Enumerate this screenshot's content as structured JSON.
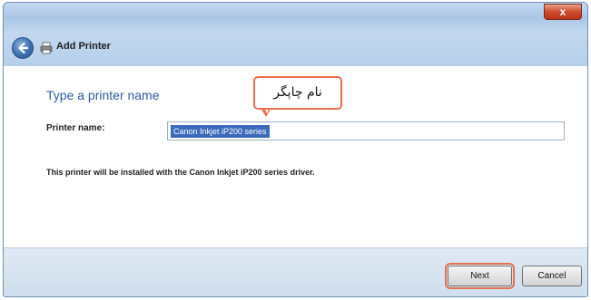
{
  "window": {
    "close_glyph": "x"
  },
  "navbar": {
    "title": "Add Printer",
    "back_icon": "back-arrow-icon",
    "printer_icon": "printer-icon"
  },
  "main": {
    "heading": "Type a printer name",
    "printer_name_label": "Printer name:",
    "printer_name_value": "Canon Inkjet iP200 series",
    "info_text": "This printer will be installed with the Canon Inkjet iP200 series driver."
  },
  "callout": {
    "text": "نام چاپگر"
  },
  "footer": {
    "next_label": "Next",
    "cancel_label": "Cancel"
  },
  "colors": {
    "accent": "#2e59a6",
    "highlight": "#e8704a",
    "selection": "#3a6ab9"
  }
}
